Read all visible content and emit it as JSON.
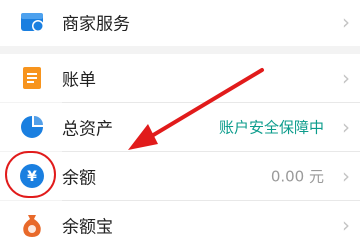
{
  "rows": [
    {
      "label": "商家服务",
      "icon": "merchant-service-icon"
    },
    {
      "label": "账单",
      "icon": "bill-icon"
    },
    {
      "label": "总资产",
      "icon": "total-assets-pie-icon",
      "value": "账户安全保障中"
    },
    {
      "label": "余额",
      "icon": "yuan-balance-icon",
      "value": "0.00 元"
    },
    {
      "label": "余额宝",
      "icon": "money-bag-icon"
    }
  ],
  "chevron": "›",
  "yen_glyph": "¥",
  "annotation": {
    "color": "#e11b1b"
  },
  "colors": {
    "blue": "#1a7fe0",
    "orange": "#f7941d",
    "teal": "#0c9c8c",
    "red": "#e11b1b",
    "money_bag": "#e8692a"
  }
}
